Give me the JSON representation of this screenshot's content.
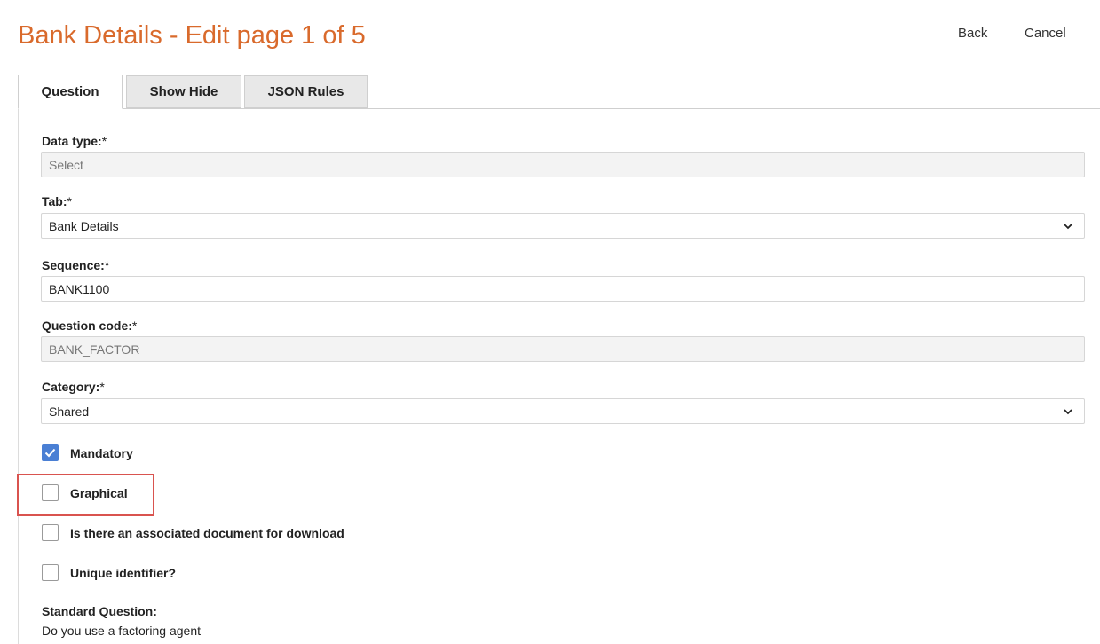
{
  "header": {
    "title": "Bank Details - Edit page 1 of 5",
    "back_label": "Back",
    "cancel_label": "Cancel"
  },
  "tabs": [
    {
      "label": "Question",
      "active": true
    },
    {
      "label": "Show Hide",
      "active": false
    },
    {
      "label": "JSON Rules",
      "active": false
    }
  ],
  "form": {
    "data_type": {
      "label": "Data type:",
      "required": "*",
      "value": "Select"
    },
    "tab": {
      "label": "Tab:",
      "required": "*",
      "value": "Bank Details"
    },
    "sequence": {
      "label": "Sequence:",
      "required": "*",
      "value": "BANK1100"
    },
    "question_code": {
      "label": "Question code:",
      "required": "*",
      "value": "BANK_FACTOR"
    },
    "category": {
      "label": "Category:",
      "required": "*",
      "value": "Shared"
    }
  },
  "checkboxes": {
    "mandatory": {
      "label": "Mandatory",
      "checked": true
    },
    "graphical": {
      "label": "Graphical",
      "checked": false
    },
    "document": {
      "label": "Is there an associated document for download",
      "checked": false
    },
    "unique": {
      "label": "Unique identifier?",
      "checked": false
    }
  },
  "standard_question": {
    "label": "Standard Question:",
    "text": "Do you use a factoring agent"
  },
  "colors": {
    "title": "#d96a2c",
    "checkbox_checked": "#4a7fd4",
    "highlight": "#d9534f"
  }
}
